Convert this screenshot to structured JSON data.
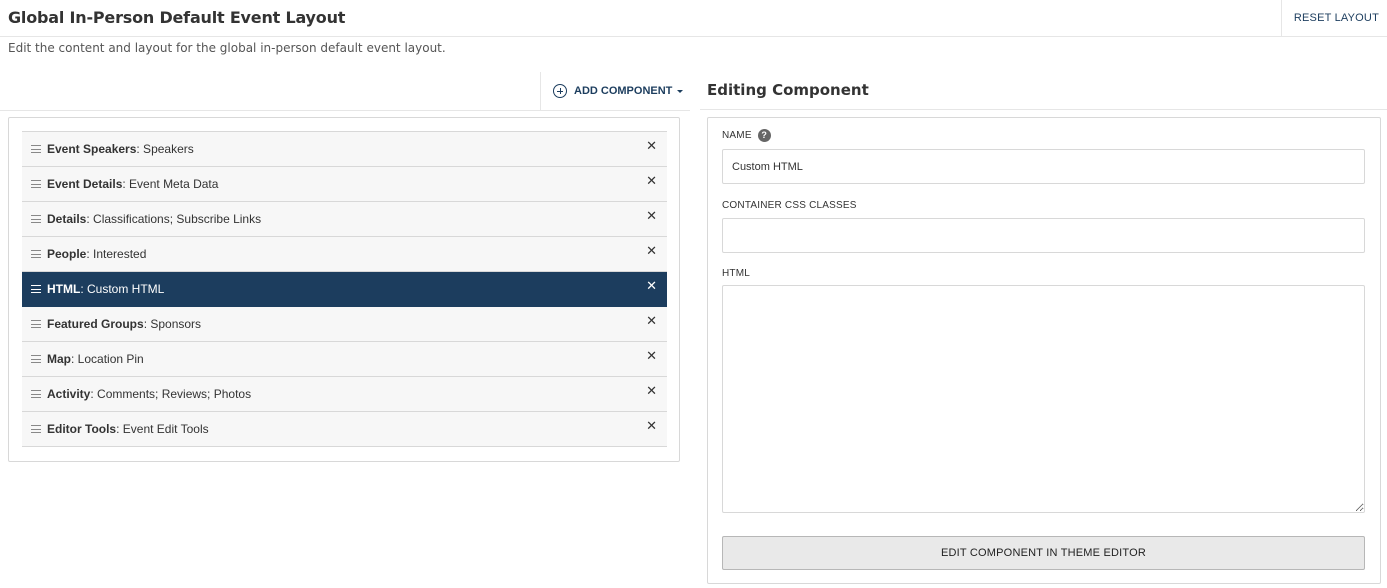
{
  "header": {
    "title": "Global In-Person Default Event Layout",
    "reset_label": "RESET LAYOUT",
    "subtitle": "Edit the content and layout for the global in-person default event layout."
  },
  "toolbar": {
    "add_component_label": "ADD COMPONENT"
  },
  "components": [
    {
      "type": "Event Speakers",
      "name": ": Speakers",
      "active": false
    },
    {
      "type": "Event Details",
      "name": ": Event Meta Data",
      "active": false
    },
    {
      "type": "Details",
      "name": ": Classifications; Subscribe Links",
      "active": false
    },
    {
      "type": "People",
      "name": ": Interested",
      "active": false
    },
    {
      "type": "HTML",
      "name": ": Custom HTML",
      "active": true
    },
    {
      "type": "Featured Groups",
      "name": ": Sponsors",
      "active": false
    },
    {
      "type": "Map",
      "name": ": Location Pin",
      "active": false
    },
    {
      "type": "Activity",
      "name": ": Comments; Reviews; Photos",
      "active": false
    },
    {
      "type": "Editor Tools",
      "name": ": Event Edit Tools",
      "active": false
    }
  ],
  "remove_glyph": "✕",
  "editor": {
    "title": "Editing Component",
    "name_label": "NAME",
    "help_glyph": "?",
    "name_value": "Custom HTML",
    "css_label": "CONTAINER CSS CLASSES",
    "css_value": "",
    "html_label": "HTML",
    "html_value": "",
    "theme_button_label": "EDIT COMPONENT IN THEME EDITOR"
  },
  "colors": {
    "accent": "#1c3d5e",
    "active_row_bg": "#1c3d5e",
    "row_bg": "#f7f7f7",
    "border": "#d8d8d8"
  }
}
